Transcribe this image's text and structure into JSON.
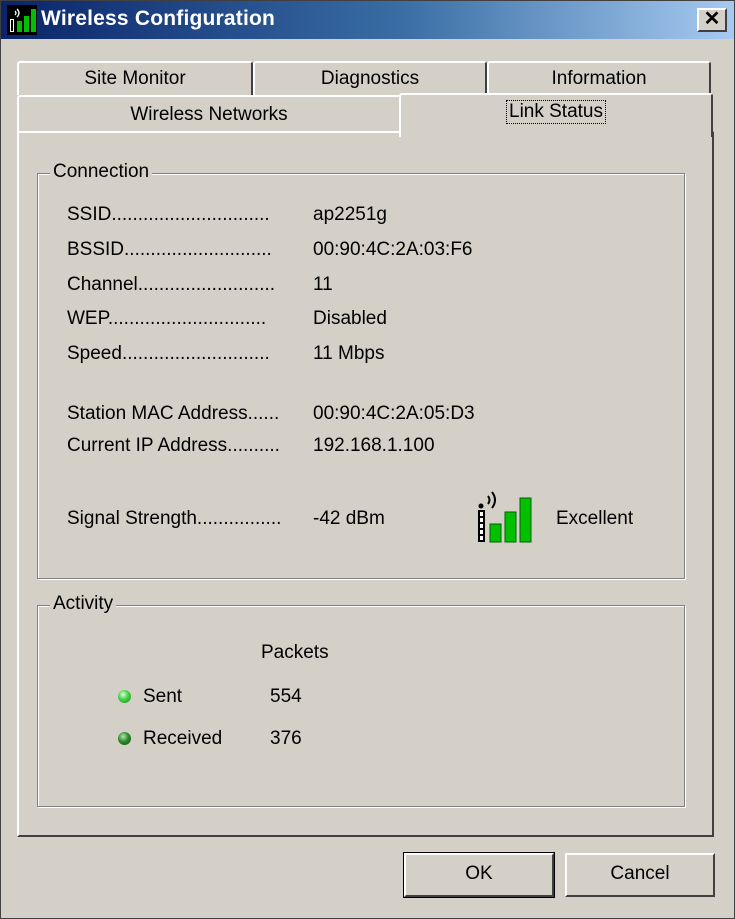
{
  "window": {
    "title": "Wireless Configuration",
    "close_glyph": "✕"
  },
  "tabs": {
    "site_monitor": "Site Monitor",
    "diagnostics": "Diagnostics",
    "information": "Information",
    "wireless_networks": "Wireless Networks",
    "link_status": "Link Status",
    "active": "Link Status"
  },
  "connection": {
    "legend": "Connection",
    "ssid": {
      "label": "SSID..............................",
      "value": "ap2251g"
    },
    "bssid": {
      "label": "BSSID............................",
      "value": "00:90:4C:2A:03:F6"
    },
    "channel": {
      "label": "Channel..........................",
      "value": "11"
    },
    "wep": {
      "label": "WEP..............................",
      "value": "Disabled"
    },
    "speed": {
      "label": "Speed............................",
      "value": "11 Mbps"
    },
    "station_mac": {
      "label": "Station MAC Address......",
      "value": "00:90:4C:2A:05:D3"
    },
    "current_ip": {
      "label": "Current IP Address..........",
      "value": "192.168.1.100"
    },
    "signal_strength": {
      "label": "Signal Strength................",
      "value": "-42 dBm",
      "quality": "Excellent",
      "bars_lit": 3,
      "bars_total": 3
    }
  },
  "activity": {
    "legend": "Activity",
    "packets_header": "Packets",
    "sent": {
      "label": "Sent",
      "value": "554"
    },
    "received": {
      "label": "Received",
      "value": "376"
    }
  },
  "buttons": {
    "ok": "OK",
    "cancel": "Cancel"
  },
  "colors": {
    "title_start": "#0a246a",
    "title_end": "#a6caf0",
    "face": "#d4d0c8",
    "signal_green": "#00c000",
    "led_sent": "#4cd64c",
    "led_received": "#2e8b2e"
  },
  "icons": [
    "wireless-signal-icon",
    "close-icon",
    "signal-strength-icon",
    "led-icon"
  ]
}
